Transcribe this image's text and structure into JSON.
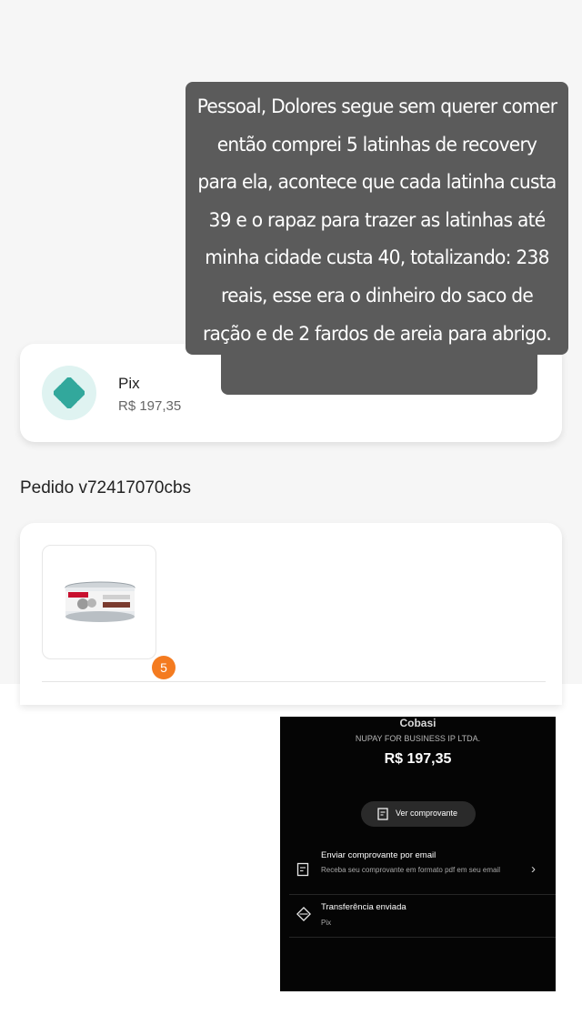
{
  "payment": {
    "method_label": "Pix",
    "amount": "R$ 197,35",
    "icon": "pix-icon"
  },
  "order": {
    "title": "Pedido v72417070cbs",
    "items": [
      {
        "icon": "pet-food-can-image",
        "quantity": "5"
      }
    ]
  },
  "story_caption": {
    "text": "Pessoal, Dolores segue sem querer comer então comprei 5 latinhas de recovery para ela, acontece que cada latinha custa 39 e o rapaz para trazer as latinhas até minha cidade custa 40, totalizando: 238 reais, esse era o dinheiro do saco de ração e de 2 fardos de areia para abrigo."
  },
  "receipt": {
    "merchant": "Cobasi",
    "processor": "NUPAY FOR BUSINESS IP LTDA.",
    "amount": "R$ 197,35",
    "view_button_label": "Ver comprovante",
    "email_row": {
      "title": "Enviar comprovante por email",
      "description": "Receba seu comprovante em formato pdf em seu email"
    },
    "transfer_row": {
      "title": "Transferência enviada",
      "description": "Pix"
    },
    "colors": {
      "background": "#050505",
      "button": "#2a2a2a"
    }
  },
  "colors": {
    "pix_teal": "#32a89c",
    "badge_orange": "#f47b20",
    "caption_bubble": "#5b5b5b"
  }
}
